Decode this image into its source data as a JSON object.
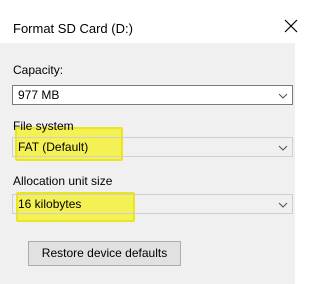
{
  "window": {
    "title": "Format SD Card (D:)",
    "close_icon": "close-icon"
  },
  "form": {
    "capacity": {
      "label": "Capacity:",
      "value": "977 MB"
    },
    "file_system": {
      "label": "File system",
      "value": "FAT (Default)"
    },
    "allocation_unit_size": {
      "label": "Allocation unit size",
      "value": "16 kilobytes"
    },
    "restore_button": "Restore device defaults"
  },
  "colors": {
    "highlight": "#f5f23a",
    "dialog_bg": "#f0f0f0"
  }
}
